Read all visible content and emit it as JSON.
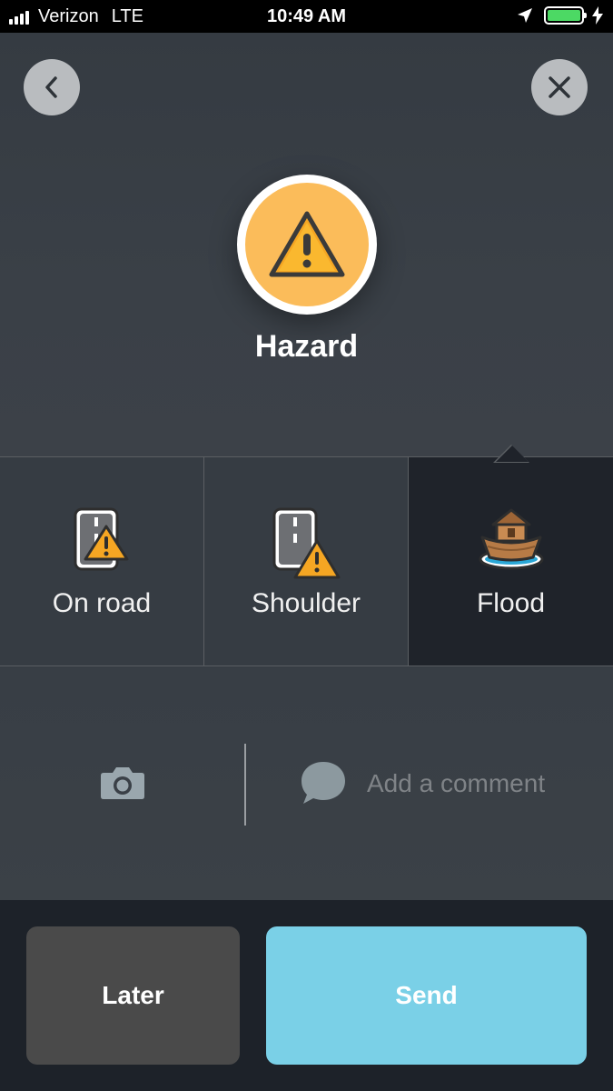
{
  "status_bar": {
    "carrier": "Verizon",
    "network": "LTE",
    "time": "10:49 AM",
    "battery_color": "#4cd964",
    "icons": [
      "signal-icon",
      "location-arrow-icon",
      "battery-icon",
      "charging-bolt-icon"
    ]
  },
  "header": {
    "back_icon": "chevron-left-icon",
    "close_icon": "close-icon",
    "category_icon": "hazard-warning-icon",
    "category_title": "Hazard",
    "accent_color": "#fbbc5a"
  },
  "options": [
    {
      "label": "On road",
      "icon": "road-hazard-icon",
      "selected": false
    },
    {
      "label": "Shoulder",
      "icon": "shoulder-hazard-icon",
      "selected": false
    },
    {
      "label": "Flood",
      "icon": "flood-ark-icon",
      "selected": true
    }
  ],
  "comment": {
    "camera_icon": "camera-icon",
    "bubble_icon": "speech-bubble-icon",
    "placeholder": "Add a comment"
  },
  "actions": {
    "later_label": "Later",
    "send_label": "Send",
    "send_color": "#7ad0e7"
  }
}
